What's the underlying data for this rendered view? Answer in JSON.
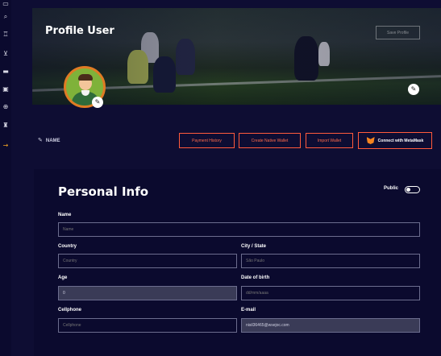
{
  "sidebar": {
    "icons": [
      "grid-icon",
      "search-icon",
      "trophy-icon",
      "cart-icon",
      "store-icon",
      "image-icon",
      "globe-icon",
      "tower-icon",
      "arrow-right-icon"
    ]
  },
  "banner": {
    "title": "Profile User",
    "save_label": "Save Profile"
  },
  "profile": {
    "name_label": "NAME"
  },
  "actions": {
    "payment_history": "Payment History",
    "create_wallet": "Create Native Wallet",
    "import_wallet": "Import Wallet",
    "connect_metamask": "Connect with MetaMask"
  },
  "personal_info": {
    "title": "Personal Info",
    "public_label": "Public",
    "public_enabled": false,
    "fields": {
      "name": {
        "label": "Name",
        "placeholder": "Name",
        "value": ""
      },
      "country": {
        "label": "Country",
        "placeholder": "Country",
        "value": ""
      },
      "city_state": {
        "label": "City / State",
        "placeholder": "São Paulo",
        "value": ""
      },
      "age": {
        "label": "Age",
        "placeholder": "",
        "value": "0"
      },
      "dob": {
        "label": "Date of birth",
        "placeholder": "dd/mm/aaaa",
        "value": ""
      },
      "cellphone": {
        "label": "Cellphone",
        "placeholder": "Cellphone",
        "value": ""
      },
      "email": {
        "label": "E-mail",
        "placeholder": "",
        "value": "nisil36465@wsejoc.com"
      }
    }
  },
  "colors": {
    "background": "#0b0a2e",
    "accent": "#ff5a3c",
    "avatar_ring": "#e07b24"
  }
}
